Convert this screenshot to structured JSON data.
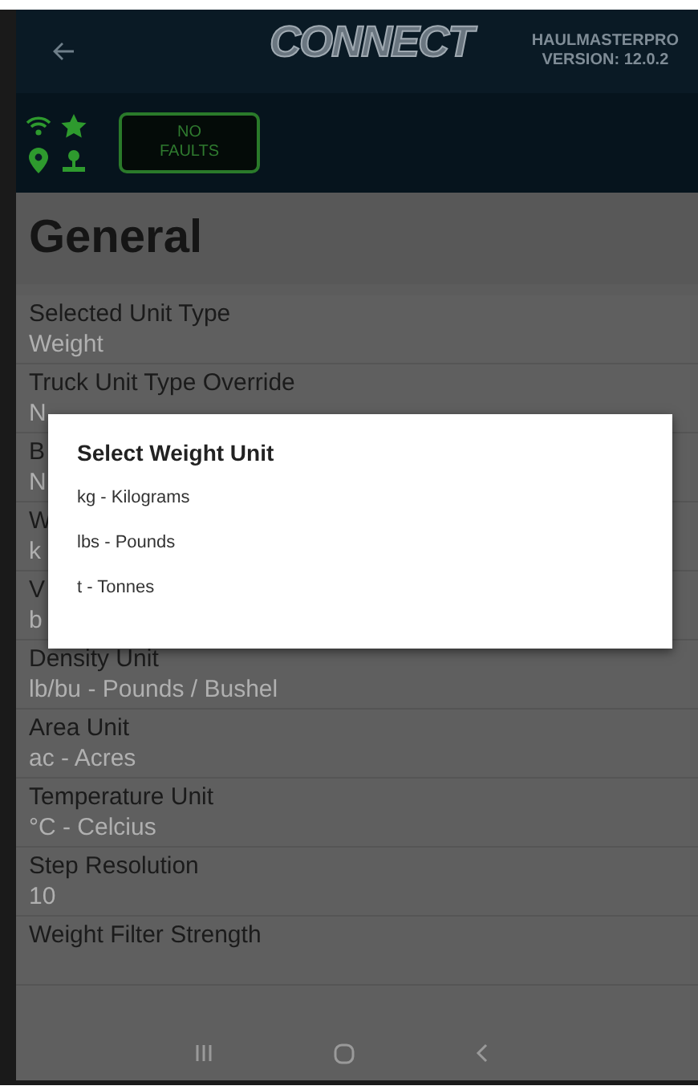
{
  "header": {
    "logo": "CONNECT",
    "app_name": "HAULMASTERPRO",
    "version": "VERSION: 12.0.2"
  },
  "status": {
    "fault_label": "NO FAULTS"
  },
  "page_title": "General",
  "settings": [
    {
      "label": "Selected Unit Type",
      "value": "Weight"
    },
    {
      "label": "Truck Unit Type Override",
      "value": "N"
    },
    {
      "label": "B",
      "value": "N"
    },
    {
      "label": "W",
      "value": "k"
    },
    {
      "label": "V",
      "value": "b"
    },
    {
      "label": "Density Unit",
      "value": "lb/bu - Pounds / Bushel"
    },
    {
      "label": "Area Unit",
      "value": "ac - Acres"
    },
    {
      "label": "Temperature Unit",
      "value": "°C - Celcius"
    },
    {
      "label": "Step Resolution",
      "value": "10"
    },
    {
      "label": "Weight Filter Strength"
    }
  ],
  "dialog": {
    "title": "Select Weight Unit",
    "options": [
      "kg - Kilograms",
      "lbs - Pounds",
      "t - Tonnes"
    ]
  }
}
